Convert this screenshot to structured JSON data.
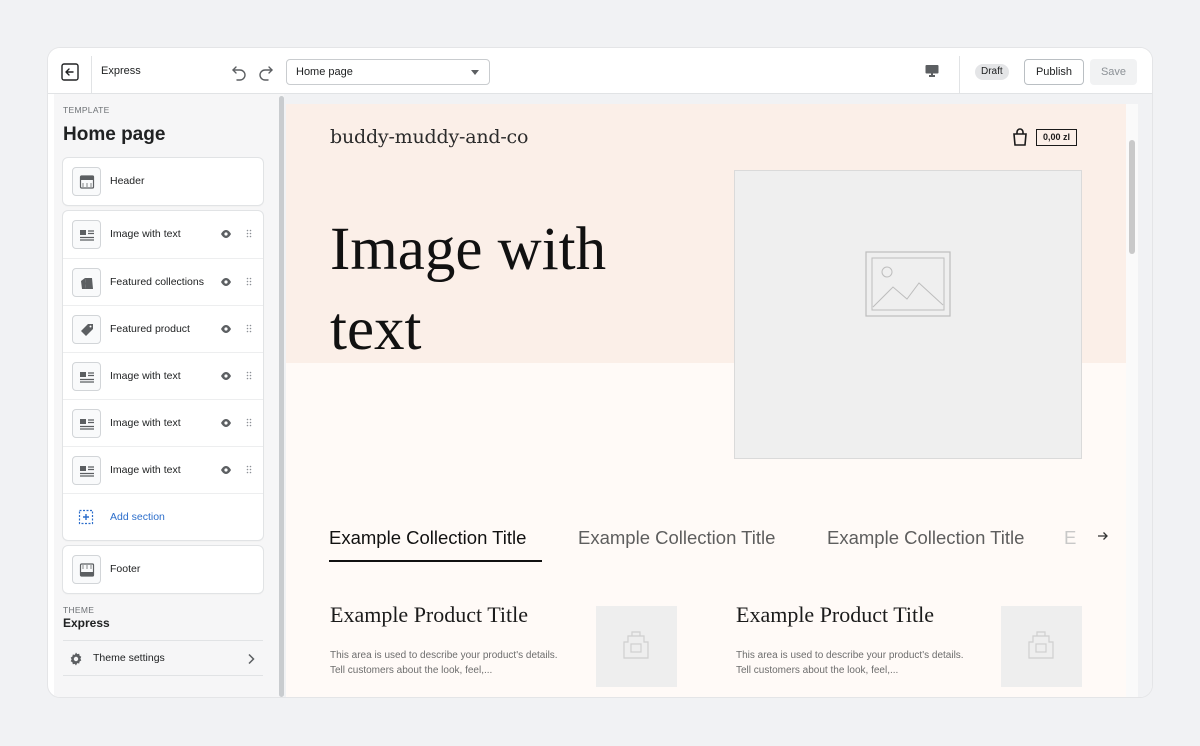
{
  "topbar": {
    "theme_name": "Express",
    "page_select_value": "Home page",
    "draft_label": "Draft",
    "publish_label": "Publish",
    "save_label": "Save"
  },
  "sidebar": {
    "template_label": "TEMPLATE",
    "template_title": "Home page",
    "header_item": "Header",
    "sections": [
      {
        "label": "Image with text"
      },
      {
        "label": "Featured collections"
      },
      {
        "label": "Featured product"
      },
      {
        "label": "Image with text"
      },
      {
        "label": "Image with text"
      },
      {
        "label": "Image with text"
      }
    ],
    "add_section_label": "Add section",
    "footer_item": "Footer",
    "theme_label": "THEME",
    "theme_name": "Express",
    "theme_settings_label": "Theme settings"
  },
  "preview": {
    "store_name": "buddy-muddy-and-co",
    "cart_total": "0,00 zl",
    "hero_title": "Image with text",
    "collection_tabs": [
      "Example Collection Title",
      "Example Collection Title",
      "Example Collection Title"
    ],
    "collection_tab_fade": "E",
    "products": [
      {
        "title": "Example Product Title",
        "description": "This area is used to describe your product's details. Tell customers about the look, feel,..."
      },
      {
        "title": "Example Product Title",
        "description": "This area is used to describe your product's details. Tell customers about the look, feel,..."
      }
    ]
  },
  "colors": {
    "accent_link": "#2c6ecb",
    "hero_band": "#fbefe8",
    "preview_bg": "#fffaf7"
  }
}
